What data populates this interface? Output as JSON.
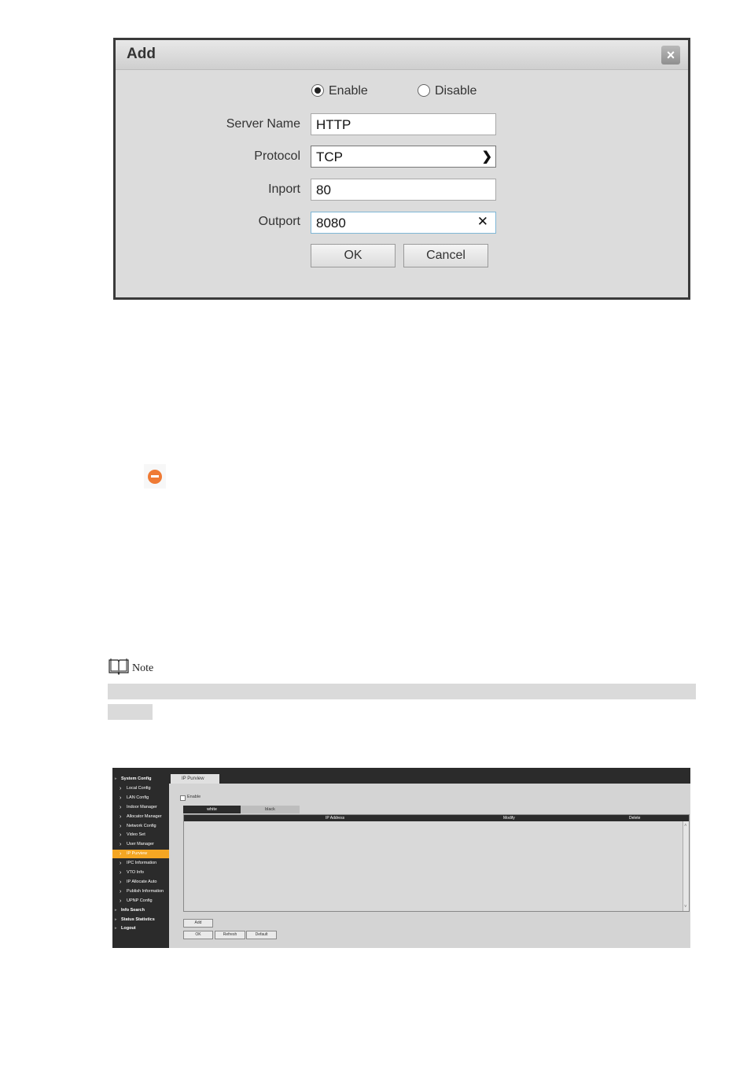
{
  "dialog": {
    "title": "Add",
    "radio_enable": "Enable",
    "radio_disable": "Disable",
    "selected": "Enable",
    "server_name_label": "Server Name",
    "server_name_value": "HTTP",
    "protocol_label": "Protocol",
    "protocol_value": "TCP",
    "inport_label": "Inport",
    "inport_value": "80",
    "outport_label": "Outport",
    "outport_value": "8080",
    "ok_label": "OK",
    "cancel_label": "Cancel"
  },
  "icons": {
    "close": "close-icon",
    "dropdown": "chevron-down-icon",
    "clear": "clear-icon",
    "delete": "minus-circle-icon",
    "note": "book-icon"
  },
  "note": {
    "label": "Note"
  },
  "screenshot": {
    "sidebar": [
      {
        "label": "System Config",
        "kind": "head"
      },
      {
        "label": "Local Config",
        "kind": "sub"
      },
      {
        "label": "LAN Config",
        "kind": "sub"
      },
      {
        "label": "Indoor Manager",
        "kind": "sub"
      },
      {
        "label": "Allocator Manager",
        "kind": "sub"
      },
      {
        "label": "Network Config",
        "kind": "sub"
      },
      {
        "label": "Video Set",
        "kind": "sub"
      },
      {
        "label": "User Manager",
        "kind": "sub"
      },
      {
        "label": "IP Purview",
        "kind": "sub",
        "active": true
      },
      {
        "label": "IPC Information",
        "kind": "sub"
      },
      {
        "label": "VTO Info",
        "kind": "sub"
      },
      {
        "label": "IP Allocate Auto",
        "kind": "sub"
      },
      {
        "label": "Publish Information",
        "kind": "sub"
      },
      {
        "label": "UPNP Config",
        "kind": "sub"
      },
      {
        "label": "Info Search",
        "kind": "head"
      },
      {
        "label": "Status Statistics",
        "kind": "head"
      },
      {
        "label": "Logout",
        "kind": "head"
      }
    ],
    "tab_label": "IP Purview",
    "enable_label": "Enable",
    "list_tabs": [
      "white",
      "black"
    ],
    "columns": [
      "IP Address",
      "Modify",
      "Delete"
    ],
    "add_label": "Add",
    "ok_label": "OK",
    "refresh_label": "Refresh",
    "default_label": "Default",
    "accent_color": "#f5a623"
  }
}
